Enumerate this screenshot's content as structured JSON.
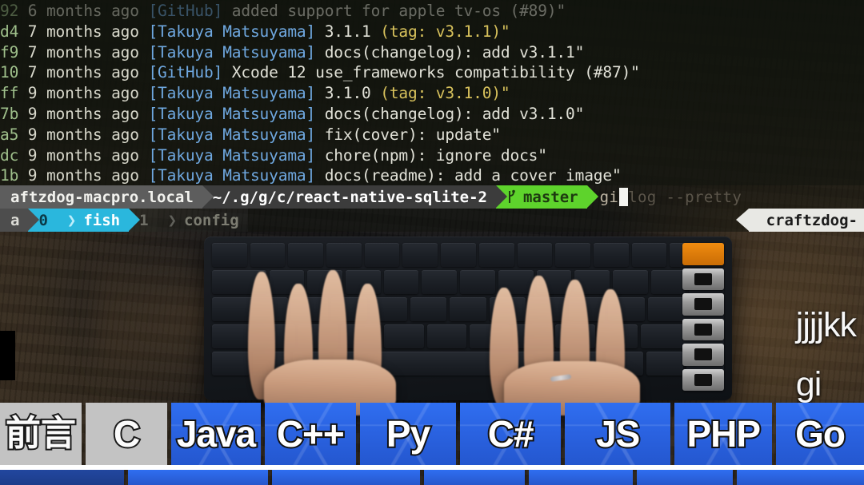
{
  "terminal": {
    "log_lines": [
      {
        "hash": "92",
        "date": "6 months ago",
        "author": "[GitHub]",
        "message": "added support for apple tv-os (#89)\"",
        "tag": "",
        "dim": true
      },
      {
        "hash": "d4",
        "date": "7 months ago",
        "author": "[Takuya Matsuyama]",
        "message": "3.1.1 ",
        "tag": "(tag: v3.1.1)\"",
        "dim": false
      },
      {
        "hash": "f9",
        "date": "7 months ago",
        "author": "[Takuya Matsuyama]",
        "message": "docs(changelog): add v3.1.1\"",
        "tag": "",
        "dim": false
      },
      {
        "hash": "10",
        "date": "7 months ago",
        "author": "[GitHub]",
        "message": "Xcode 12 use_frameworks compatibility (#87)\"",
        "tag": "",
        "dim": false
      },
      {
        "hash": "ff",
        "date": "9 months ago",
        "author": "[Takuya Matsuyama]",
        "message": "3.1.0 ",
        "tag": "(tag: v3.1.0)\"",
        "dim": false
      },
      {
        "hash": "7b",
        "date": "9 months ago",
        "author": "[Takuya Matsuyama]",
        "message": "docs(changelog): add v3.1.0\"",
        "tag": "",
        "dim": false
      },
      {
        "hash": "a5",
        "date": "9 months ago",
        "author": "[Takuya Matsuyama]",
        "message": "fix(cover): update\"",
        "tag": "",
        "dim": false
      },
      {
        "hash": "dc",
        "date": "9 months ago",
        "author": "[Takuya Matsuyama]",
        "message": "chore(npm): ignore docs\"",
        "tag": "",
        "dim": false
      },
      {
        "hash": "1b",
        "date": "9 months ago",
        "author": "[Takuya Matsuyama]",
        "message": "docs(readme): add a cover image\"",
        "tag": "",
        "dim": false
      }
    ]
  },
  "prompt": {
    "host": "aftzdog-macpro.local",
    "path": "~/.g/g/c/react-native-sqlite-2",
    "git_icon": "git-branch-icon",
    "branch": "master",
    "typed_command": "git",
    "ghost_suggestion": " log --pretty ",
    "right_prompt": "craftzdog-",
    "row2": {
      "user": "a",
      "status_code": "0",
      "shell": "fish",
      "jobs": "1",
      "context": "config"
    }
  },
  "keystroke_overlay": {
    "lines": [
      "jjjjkk",
      "gi"
    ]
  },
  "tabbar": {
    "tabs": [
      {
        "label": "前言",
        "style": "gray",
        "width": 104
      },
      {
        "label": "C",
        "style": "gray",
        "width": 104
      },
      {
        "label": "Java",
        "style": "blue",
        "width": 114
      },
      {
        "label": "C++",
        "style": "blue",
        "width": 116
      },
      {
        "label": "Py",
        "style": "blue",
        "width": 123
      },
      {
        "label": "C#",
        "style": "blue",
        "width": 128
      },
      {
        "label": "JS",
        "style": "blue",
        "width": 135
      },
      {
        "label": "PHP",
        "style": "blue",
        "width": 124
      },
      {
        "label": "Go",
        "style": "blue",
        "width": 112
      }
    ],
    "row2": [
      {
        "width": 158,
        "style": "dark"
      },
      {
        "width": 178,
        "style": "light"
      },
      {
        "width": 188,
        "style": "light"
      },
      {
        "width": 128,
        "style": "light"
      },
      {
        "width": 132,
        "style": "light"
      },
      {
        "width": 122,
        "style": "light"
      },
      {
        "width": 162,
        "style": "light"
      }
    ]
  },
  "colors": {
    "accent_blue": "#2f6ef0",
    "tab_gray": "#c3c3c3",
    "git_green": "#5ed32c",
    "fish_cyan": "#2ab7dd",
    "terminal_bg": "#101410"
  }
}
